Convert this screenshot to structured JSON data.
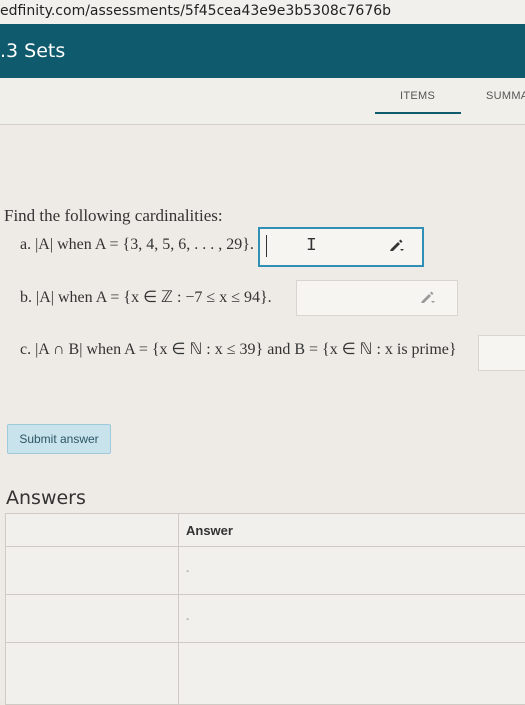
{
  "browser": {
    "url": "edfinity.com/assessments/5f45cea43e9e3b5308c7676b"
  },
  "header": {
    "title": ".3 Sets"
  },
  "tabs": [
    {
      "label": "ITEMS"
    },
    {
      "label": "SUMMA"
    }
  ],
  "question": {
    "prompt": "Find the following cardinalities:",
    "parts": [
      {
        "label": "a. |A| when A = {3, 4, 5, 6, . . . , 29}."
      },
      {
        "label": "b. |A| when A = {x ∈ ℤ : −7 ≤ x ≤ 94}."
      },
      {
        "label": "c. |A ∩ B| when A = {x ∈ ℕ : x ≤ 39} and B = {x ∈ ℕ : x is prime}"
      }
    ]
  },
  "submit": {
    "label": "Submit answer"
  },
  "answers": {
    "title": "Answers",
    "column_header": "Answer",
    "rows": [
      "-",
      "-"
    ]
  },
  "icons": {
    "edit": "pencil-icon",
    "text_cursor": "i-beam-cursor-icon"
  }
}
